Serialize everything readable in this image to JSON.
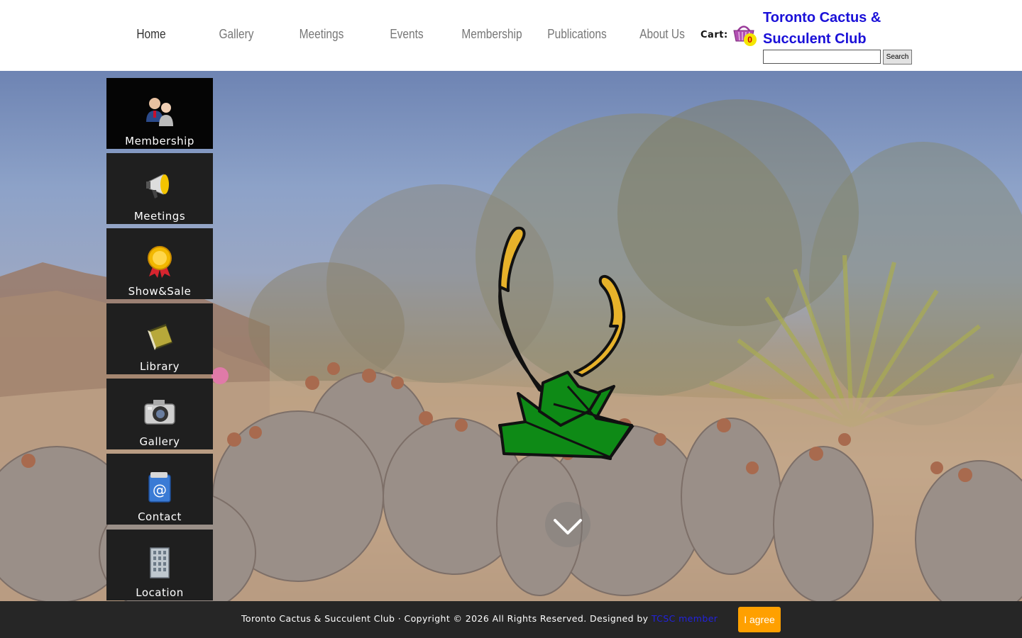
{
  "nav": {
    "items": [
      {
        "label": "Home",
        "active": true
      },
      {
        "label": "Gallery",
        "active": false
      },
      {
        "label": "Meetings",
        "active": false
      },
      {
        "label": "Events",
        "active": false
      },
      {
        "label": "Membership",
        "active": false
      },
      {
        "label": "Publications",
        "active": false
      },
      {
        "label": "About Us",
        "active": false
      }
    ]
  },
  "cart": {
    "label": "Cart:",
    "count": "0",
    "icon": "basket-icon"
  },
  "brand": {
    "line1": "Toronto Cactus &",
    "line2": "Succulent Club",
    "color": "#1a10d8"
  },
  "search": {
    "placeholder": "",
    "button_label": "Search"
  },
  "side_menu": {
    "items": [
      {
        "label": "Membership",
        "icon": "users-icon"
      },
      {
        "label": "Meetings",
        "icon": "megaphone-icon"
      },
      {
        "label": "Show&Sale",
        "icon": "medal-icon"
      },
      {
        "label": "Library",
        "icon": "book-icon"
      },
      {
        "label": "Gallery",
        "icon": "camera-icon"
      },
      {
        "label": "Contact",
        "icon": "email-icon"
      },
      {
        "label": "Location",
        "icon": "building-icon"
      }
    ]
  },
  "hero": {
    "logo_icon": "cactus-logo-icon",
    "scroll_icon": "chevron-down-icon"
  },
  "footer": {
    "text": "Toronto Cactus & Succulent Club · Copyright © 2026 All Rights Reserved. Designed by",
    "link": "TCSC member",
    "agree_label": "I agree",
    "agree_color": "#ffa000"
  }
}
